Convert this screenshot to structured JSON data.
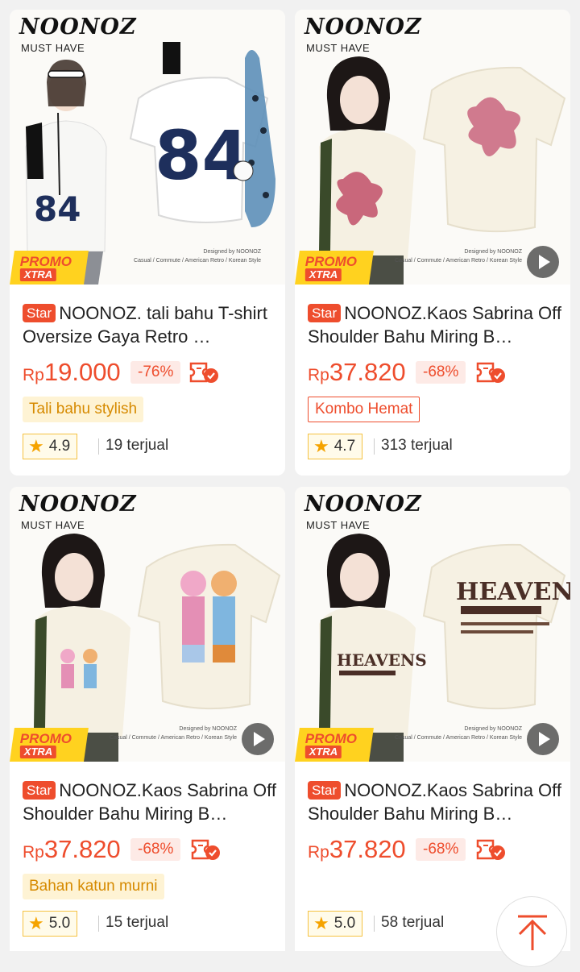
{
  "products": [
    {
      "brand": "NOONOZ",
      "tagline": "MUST HAVE",
      "designed": "Designed by NOONOZ",
      "styles": "Casual / Commute / American Retro / Korean Style",
      "print_text": "84",
      "badge": "Star",
      "title": "NOONOZ. tali bahu T-shirt Oversize Gaya Retro …",
      "currency": "Rp",
      "price": "19.000",
      "discount": "-76%",
      "label": "Tali bahu stylish",
      "rating": "4.9",
      "sold": "19 terjual",
      "promo_line1": "PROMO",
      "promo_line2": "XTRA"
    },
    {
      "brand": "NOONOZ",
      "tagline": "MUST HAVE",
      "designed": "Designed by NOONOZ",
      "styles": "Casual / Commute / American Retro / Korean Style",
      "badge": "Star",
      "title": "NOONOZ.Kaos Sabrina Off Shoulder Bahu Miring B…",
      "currency": "Rp",
      "price": "37.820",
      "discount": "-68%",
      "label": "Kombo Hemat",
      "rating": "4.7",
      "sold": "313 terjual",
      "promo_line1": "PROMO",
      "promo_line2": "XTRA"
    },
    {
      "brand": "NOONOZ",
      "tagline": "MUST HAVE",
      "designed": "Designed by NOONOZ",
      "styles": "Casual / Commute / American Retro / Korean Style",
      "badge": "Star",
      "title": "NOONOZ.Kaos Sabrina Off Shoulder Bahu Miring B…",
      "currency": "Rp",
      "price": "37.820",
      "discount": "-68%",
      "label": "Bahan katun murni",
      "rating": "5.0",
      "sold": "15 terjual",
      "promo_line1": "PROMO",
      "promo_line2": "XTRA"
    },
    {
      "brand": "NOONOZ",
      "tagline": "MUST HAVE",
      "designed": "Designed by NOONOZ",
      "styles": "Casual / Commute / American Retro / Korean Style",
      "print_text": "HEAVENS",
      "badge": "Star",
      "title": "NOONOZ.Kaos Sabrina Off Shoulder Bahu Miring B…",
      "currency": "Rp",
      "price": "37.820",
      "discount": "-68%",
      "label": "",
      "rating": "5.0",
      "sold": "58 terjual",
      "promo_line1": "PROMO",
      "promo_line2": "XTRA"
    }
  ],
  "colors": {
    "accent": "#ee4d2d",
    "promo_yellow": "#ffd21f",
    "label_fill_bg": "#fef3d4",
    "label_fill_text": "#d68a00",
    "rating_star": "#f5a300"
  },
  "icons": {
    "play": "play-icon",
    "voucher": "voucher-check-icon",
    "star": "star-icon",
    "back_to_top": "arrow-up-icon"
  }
}
